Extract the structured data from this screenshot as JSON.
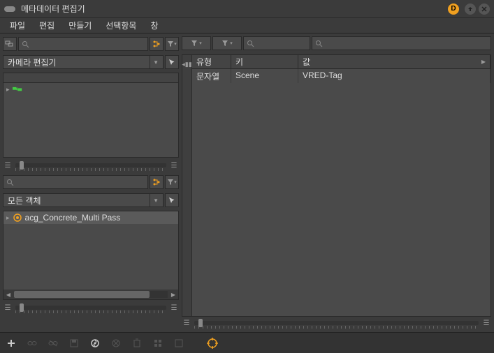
{
  "titlebar": {
    "title": "메타데이터 편집기",
    "d_badge": "D"
  },
  "menubar": {
    "items": [
      "파일",
      "편집",
      "만들기",
      "선택항목",
      "창"
    ]
  },
  "left": {
    "top_dropdown": "카메라 편집기",
    "bottom_dropdown": "모든 객체",
    "tree1_label": "",
    "tree2_item": "acg_Concrete_Multi Pass"
  },
  "right": {
    "columns": {
      "type": "유형",
      "key": "키",
      "value": "값"
    },
    "rows": [
      {
        "type": "문자열",
        "key": "Scene",
        "value": "VRED-Tag"
      }
    ]
  }
}
